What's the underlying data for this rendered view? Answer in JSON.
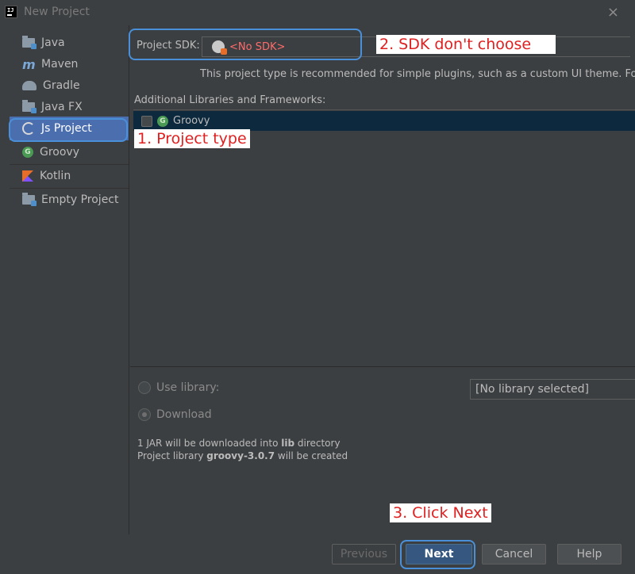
{
  "window": {
    "title": "New Project",
    "close_glyph": "×"
  },
  "sidebar": {
    "items": [
      {
        "label": "Java",
        "icon": "folder-icon"
      },
      {
        "label": "Maven",
        "icon": "maven-icon"
      },
      {
        "label": "Gradle",
        "icon": "gradle-icon"
      },
      {
        "label": "Java FX",
        "icon": "folder-icon"
      },
      {
        "label": "Js Project",
        "icon": "js-project-icon",
        "selected": true
      },
      {
        "label": "Groovy",
        "icon": "groovy-icon"
      },
      {
        "label": "Kotlin",
        "icon": "kotlin-icon"
      },
      {
        "label": "Empty Project",
        "icon": "folder-icon"
      }
    ]
  },
  "sdk": {
    "label": "Project SDK:",
    "value": "<No SDK>",
    "hint": "This project type is recommended for simple plugins, such as a custom UI theme. For m"
  },
  "libraries": {
    "label": "Additional Libraries and Frameworks:",
    "items": [
      {
        "label": "Groovy",
        "icon": "groovy-icon",
        "checked": false
      }
    ]
  },
  "options": {
    "use_library": "Use library:",
    "download": "Download",
    "library_select": "[No library selected]",
    "info_line1_pre": "1 JAR will be downloaded into ",
    "info_line1_bold": "lib",
    "info_line1_post": " directory",
    "info_line2_pre": "Project library ",
    "info_line2_bold": "groovy-3.0.7",
    "info_line2_post": " will be created"
  },
  "buttons": {
    "previous": "Previous",
    "next": "Next",
    "cancel": "Cancel",
    "help": "Help"
  },
  "annotations": {
    "project_type": "1. Project type",
    "sdk": "2.  SDK don't choose",
    "next": "3. Click Next"
  },
  "colors": {
    "background": "#3c3f41",
    "selection": "#4b6eaf",
    "annotation_border": "#4a90d9",
    "annotation_text": "#e02020",
    "no_sdk": "#ff6b6b"
  }
}
